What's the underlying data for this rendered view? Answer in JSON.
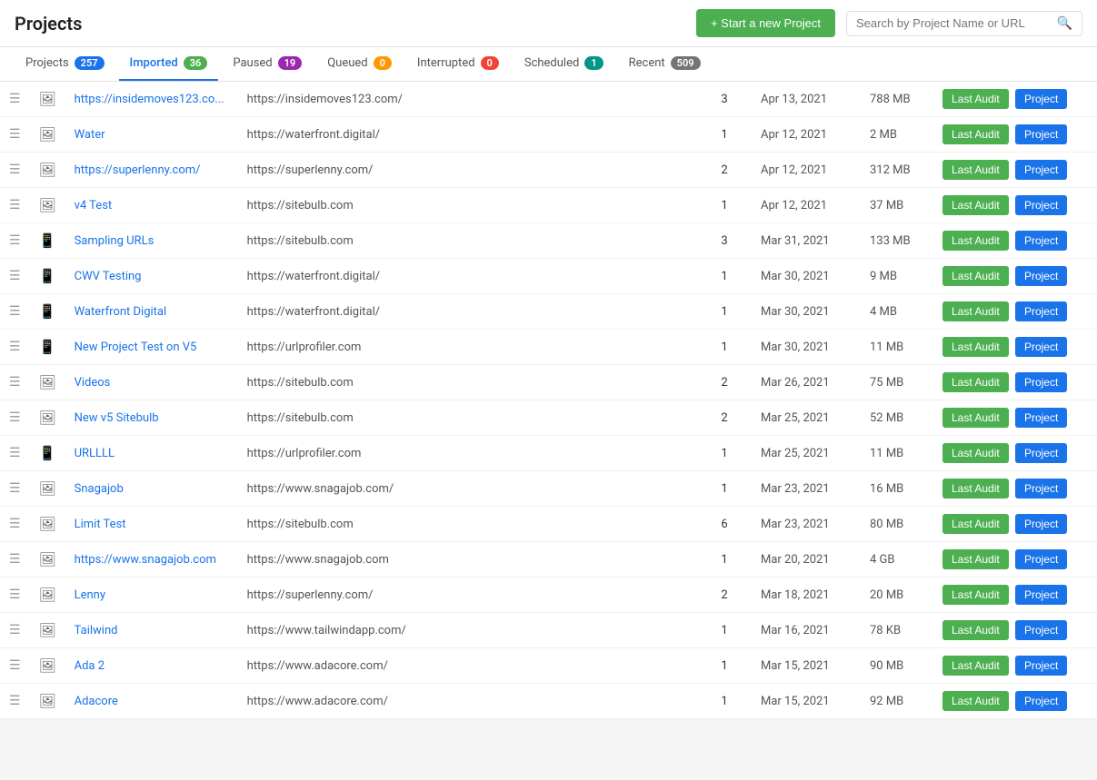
{
  "header": {
    "title": "Projects",
    "new_project_label": "+ Start a new Project",
    "search_placeholder": "Search by Project Name or URL"
  },
  "tabs": [
    {
      "id": "projects",
      "label": "Projects",
      "count": "257",
      "badge_class": "badge-blue",
      "active": false
    },
    {
      "id": "imported",
      "label": "Imported",
      "count": "36",
      "badge_class": "badge-green",
      "active": true
    },
    {
      "id": "paused",
      "label": "Paused",
      "count": "19",
      "badge_class": "badge-purple",
      "active": false
    },
    {
      "id": "queued",
      "label": "Queued",
      "count": "0",
      "badge_class": "badge-orange",
      "active": false
    },
    {
      "id": "interrupted",
      "label": "Interrupted",
      "count": "0",
      "badge_class": "badge-red",
      "active": false
    },
    {
      "id": "scheduled",
      "label": "Scheduled",
      "count": "1",
      "badge_class": "badge-teal",
      "active": false
    },
    {
      "id": "recent",
      "label": "Recent",
      "count": "509",
      "badge_class": "badge-gray",
      "active": false
    }
  ],
  "table": {
    "btn_last_audit": "Last Audit",
    "btn_project": "Project",
    "rows": [
      {
        "id": "row1",
        "name": "https://insidemoves123.co...",
        "name_is_link": true,
        "url": "https://insidemoves123.com/",
        "audits": "3",
        "date": "Apr 13, 2021",
        "size": "788 MB",
        "device": "desktop"
      },
      {
        "id": "row2",
        "name": "Water",
        "name_is_link": true,
        "url": "https://waterfront.digital/",
        "audits": "1",
        "date": "Apr 12, 2021",
        "size": "2 MB",
        "device": "desktop"
      },
      {
        "id": "row3",
        "name": "https://superlenny.com/",
        "name_is_link": true,
        "url": "https://superlenny.com/",
        "audits": "2",
        "date": "Apr 12, 2021",
        "size": "312 MB",
        "device": "desktop"
      },
      {
        "id": "row4",
        "name": "v4 Test",
        "name_is_link": true,
        "url": "https://sitebulb.com",
        "audits": "1",
        "date": "Apr 12, 2021",
        "size": "37 MB",
        "device": "desktop"
      },
      {
        "id": "row5",
        "name": "Sampling URLs",
        "name_is_link": true,
        "url": "https://sitebulb.com",
        "audits": "3",
        "date": "Mar 31, 2021",
        "size": "133 MB",
        "device": "mobile"
      },
      {
        "id": "row6",
        "name": "CWV Testing",
        "name_is_link": true,
        "url": "https://waterfront.digital/",
        "audits": "1",
        "date": "Mar 30, 2021",
        "size": "9 MB",
        "device": "mobile"
      },
      {
        "id": "row7",
        "name": "Waterfront Digital",
        "name_is_link": true,
        "url": "https://waterfront.digital/",
        "audits": "1",
        "date": "Mar 30, 2021",
        "size": "4 MB",
        "device": "mobile"
      },
      {
        "id": "row8",
        "name": "New Project Test on V5",
        "name_is_link": true,
        "url": "https://urlprofiler.com",
        "audits": "1",
        "date": "Mar 30, 2021",
        "size": "11 MB",
        "device": "mobile"
      },
      {
        "id": "row9",
        "name": "Videos",
        "name_is_link": true,
        "url": "https://sitebulb.com",
        "audits": "2",
        "date": "Mar 26, 2021",
        "size": "75 MB",
        "device": "desktop"
      },
      {
        "id": "row10",
        "name": "New v5 Sitebulb",
        "name_is_link": true,
        "url": "https://sitebulb.com",
        "audits": "2",
        "date": "Mar 25, 2021",
        "size": "52 MB",
        "device": "desktop"
      },
      {
        "id": "row11",
        "name": "URLLLL",
        "name_is_link": true,
        "url": "https://urlprofiler.com",
        "audits": "1",
        "date": "Mar 25, 2021",
        "size": "11 MB",
        "device": "mobile"
      },
      {
        "id": "row12",
        "name": "Snagajob",
        "name_is_link": true,
        "url": "https://www.snagajob.com/",
        "audits": "1",
        "date": "Mar 23, 2021",
        "size": "16 MB",
        "device": "desktop"
      },
      {
        "id": "row13",
        "name": "Limit Test",
        "name_is_link": true,
        "url": "https://sitebulb.com",
        "audits": "6",
        "date": "Mar 23, 2021",
        "size": "80 MB",
        "device": "desktop"
      },
      {
        "id": "row14",
        "name": "https://www.snagajob.com",
        "name_is_link": true,
        "url": "https://www.snagajob.com",
        "audits": "1",
        "date": "Mar 20, 2021",
        "size": "4 GB",
        "device": "desktop"
      },
      {
        "id": "row15",
        "name": "Lenny",
        "name_is_link": true,
        "url": "https://superlenny.com/",
        "audits": "2",
        "date": "Mar 18, 2021",
        "size": "20 MB",
        "device": "desktop"
      },
      {
        "id": "row16",
        "name": "Tailwind",
        "name_is_link": true,
        "url": "https://www.tailwindapp.com/",
        "audits": "1",
        "date": "Mar 16, 2021",
        "size": "78 KB",
        "device": "desktop"
      },
      {
        "id": "row17",
        "name": "Ada 2",
        "name_is_link": true,
        "url": "https://www.adacore.com/",
        "audits": "1",
        "date": "Mar 15, 2021",
        "size": "90 MB",
        "device": "desktop"
      },
      {
        "id": "row18",
        "name": "Adacore",
        "name_is_link": true,
        "url": "https://www.adacore.com/",
        "audits": "1",
        "date": "Mar 15, 2021",
        "size": "92 MB",
        "device": "desktop"
      }
    ]
  }
}
